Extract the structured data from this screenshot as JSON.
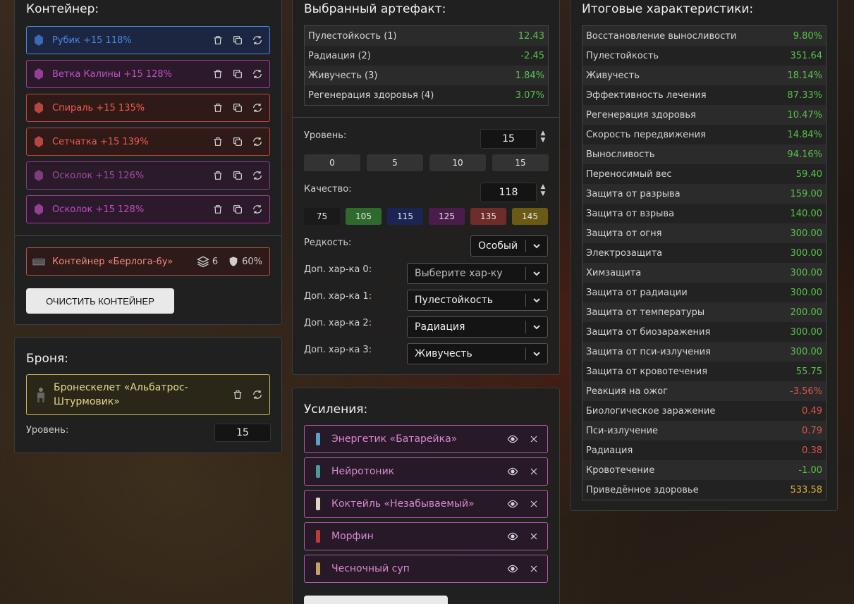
{
  "container": {
    "title": "Контейнер:",
    "artifacts": [
      {
        "name": "Рубик +15 118%",
        "color": "#4a86e8",
        "border": "#4a86e8",
        "bg": "#1c2640",
        "icon": "cube-icon"
      },
      {
        "name": "Ветка Калины +15 128%",
        "color": "#c04fc0",
        "border": "#a03aa0",
        "bg": "#2c1a2c",
        "icon": "branch-icon"
      },
      {
        "name": "Спираль +15 135%",
        "color": "#f05a4f",
        "border": "#c0463e",
        "bg": "#301a18",
        "icon": "spiral-icon"
      },
      {
        "name": "Сетчатка +15 139%",
        "color": "#f05a4f",
        "border": "#c0463e",
        "bg": "#301a18",
        "icon": "mesh-icon"
      },
      {
        "name": "Осколок +15 126%",
        "color": "#a74aa7",
        "border": "#8a3a8a",
        "bg": "#2a1a2a",
        "icon": "shard-icon"
      },
      {
        "name": "Осколок +15 128%",
        "color": "#c04fc0",
        "border": "#a03aa0",
        "bg": "#2c1a2c",
        "icon": "shard-icon"
      }
    ],
    "box": {
      "name": "Контейнер «Берлога-6у»",
      "slots": "6",
      "protection": "60%"
    },
    "clear_label": "ОЧИСТИТЬ КОНТЕЙНЕР"
  },
  "armor": {
    "title": "Броня:",
    "name": "Бронескелет «Альбатрос-Штурмовик»",
    "level_label": "Уровень:",
    "level_value": "15"
  },
  "artifact": {
    "title": "Выбранный артефакт:",
    "stats": [
      {
        "label": "Пулестойкость (1)",
        "value": "12.43",
        "tone": "green"
      },
      {
        "label": "Радиация (2)",
        "value": "-2.45",
        "tone": "green"
      },
      {
        "label": "Живучесть (3)",
        "value": "1.84%",
        "tone": "green"
      },
      {
        "label": "Регенерация здоровья (4)",
        "value": "3.07%",
        "tone": "green"
      }
    ],
    "level_label": "Уровень:",
    "level_value": "15",
    "level_presets": [
      "0",
      "5",
      "10",
      "15"
    ],
    "quality_label": "Качество:",
    "quality_value": "118",
    "quality_presets": [
      {
        "label": "75",
        "bg": "#1a1a1a"
      },
      {
        "label": "105",
        "bg": "#2e6a2e"
      },
      {
        "label": "115",
        "bg": "#1c2454"
      },
      {
        "label": "125",
        "bg": "#4a1c4a"
      },
      {
        "label": "135",
        "bg": "#6e2c2a"
      },
      {
        "label": "145",
        "bg": "#6a5a14"
      }
    ],
    "rarity_label": "Редкость:",
    "rarity_value": "Особый",
    "extra": [
      {
        "label": "Доп. хар-ка 0:",
        "value": "Выберите хар-ку",
        "placeholder": true
      },
      {
        "label": "Доп. хар-ка 1:",
        "value": "Пулестойкость",
        "placeholder": false
      },
      {
        "label": "Доп. хар-ка 2:",
        "value": "Радиация",
        "placeholder": false
      },
      {
        "label": "Доп. хар-ка 3:",
        "value": "Живучесть",
        "placeholder": false
      }
    ]
  },
  "boosts": {
    "title": "Усиления:",
    "items": [
      {
        "name": "Энергетик «Батарейка»",
        "icon": "energy-drink-icon"
      },
      {
        "name": "Нейротоник",
        "icon": "bottle-icon"
      },
      {
        "name": "Коктейль «Незабываемый»",
        "icon": "cocktail-icon"
      },
      {
        "name": "Морфин",
        "icon": "syringe-icon"
      },
      {
        "name": "Чесночный суп",
        "icon": "soup-icon"
      }
    ]
  },
  "summary": {
    "title": "Итоговые характеристики:",
    "stats": [
      {
        "label": "Восстановление выносливости",
        "value": "9.80%",
        "tone": "green"
      },
      {
        "label": "Пулестойкость",
        "value": "351.64",
        "tone": "green"
      },
      {
        "label": "Живучесть",
        "value": "18.14%",
        "tone": "green"
      },
      {
        "label": "Эффективность лечения",
        "value": "87.33%",
        "tone": "green"
      },
      {
        "label": "Регенерация здоровья",
        "value": "10.47%",
        "tone": "green"
      },
      {
        "label": "Скорость передвижения",
        "value": "14.84%",
        "tone": "green"
      },
      {
        "label": "Выносливость",
        "value": "94.16%",
        "tone": "green"
      },
      {
        "label": "Переносимый вес",
        "value": "59.40",
        "tone": "green"
      },
      {
        "label": "Защита от разрыва",
        "value": "159.00",
        "tone": "green"
      },
      {
        "label": "Защита от взрыва",
        "value": "140.00",
        "tone": "green"
      },
      {
        "label": "Защита от огня",
        "value": "300.00",
        "tone": "green"
      },
      {
        "label": "Электрозащита",
        "value": "300.00",
        "tone": "green"
      },
      {
        "label": "Химзащита",
        "value": "300.00",
        "tone": "green"
      },
      {
        "label": "Защита от радиации",
        "value": "300.00",
        "tone": "green"
      },
      {
        "label": "Защита от температуры",
        "value": "200.00",
        "tone": "green"
      },
      {
        "label": "Защита от биозаражения",
        "value": "300.00",
        "tone": "green"
      },
      {
        "label": "Защита от пси-излучения",
        "value": "300.00",
        "tone": "green"
      },
      {
        "label": "Защита от кровотечения",
        "value": "55.75",
        "tone": "green"
      },
      {
        "label": "Реакция на ожог",
        "value": "-3.56%",
        "tone": "red"
      },
      {
        "label": "Биологическое заражение",
        "value": "0.49",
        "tone": "red"
      },
      {
        "label": "Пси-излучение",
        "value": "0.79",
        "tone": "red"
      },
      {
        "label": "Радиация",
        "value": "0.38",
        "tone": "red"
      },
      {
        "label": "Кровотечение",
        "value": "-1.00",
        "tone": "green"
      },
      {
        "label": "Приведённое здоровье",
        "value": "533.58",
        "tone": "gold"
      }
    ]
  }
}
